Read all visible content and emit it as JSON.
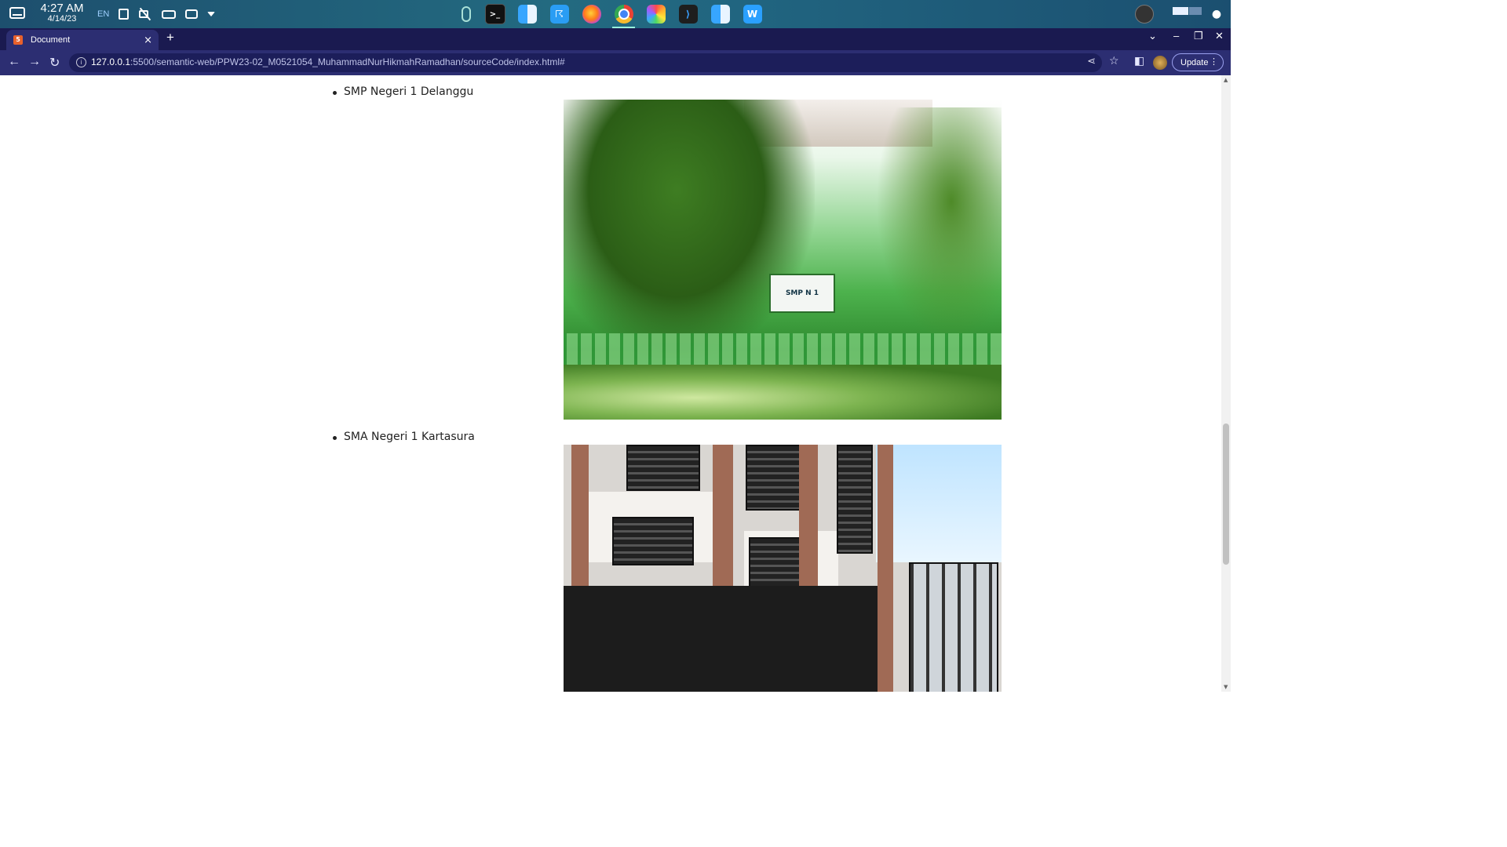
{
  "os_panel": {
    "time": "4:27 AM",
    "date": "4/14/23",
    "language": "EN",
    "icons": [
      "desktop-icon",
      "clipboard-icon",
      "mute-icon",
      "battery-icon",
      "display-icon",
      "dropdown-icon"
    ],
    "dock": [
      "terminal",
      "finder",
      "file-manager",
      "firefox",
      "chrome",
      "photos",
      "vscode",
      "finder",
      "wps-writer"
    ],
    "active_app": "chrome"
  },
  "browser": {
    "tab": {
      "title": "Document",
      "close": "×"
    },
    "new_tab": "+",
    "window_controls": {
      "dropdown": "⌄",
      "minimize": "–",
      "restore": "❐",
      "close": "✕"
    },
    "nav": {
      "back": "←",
      "forward": "→",
      "reload": "↻"
    },
    "url_host": "127.0.0.1",
    "url_rest": ":5500/semantic-web/PPW23-02_M0521054_MuhammadNurHikmahRamadhan/sourceCode/index.html#",
    "update_label": "Update"
  },
  "page": {
    "items": [
      {
        "label": "SMP Negeri 1 Delanggu",
        "sign_text": "SMP N 1"
      },
      {
        "label": "SMA Negeri 1 Kartasura"
      }
    ]
  },
  "colors": {
    "tab_active": "#2c2e72",
    "tabstrip": "#1a1a50",
    "omnibox": "#1c1e5a"
  }
}
